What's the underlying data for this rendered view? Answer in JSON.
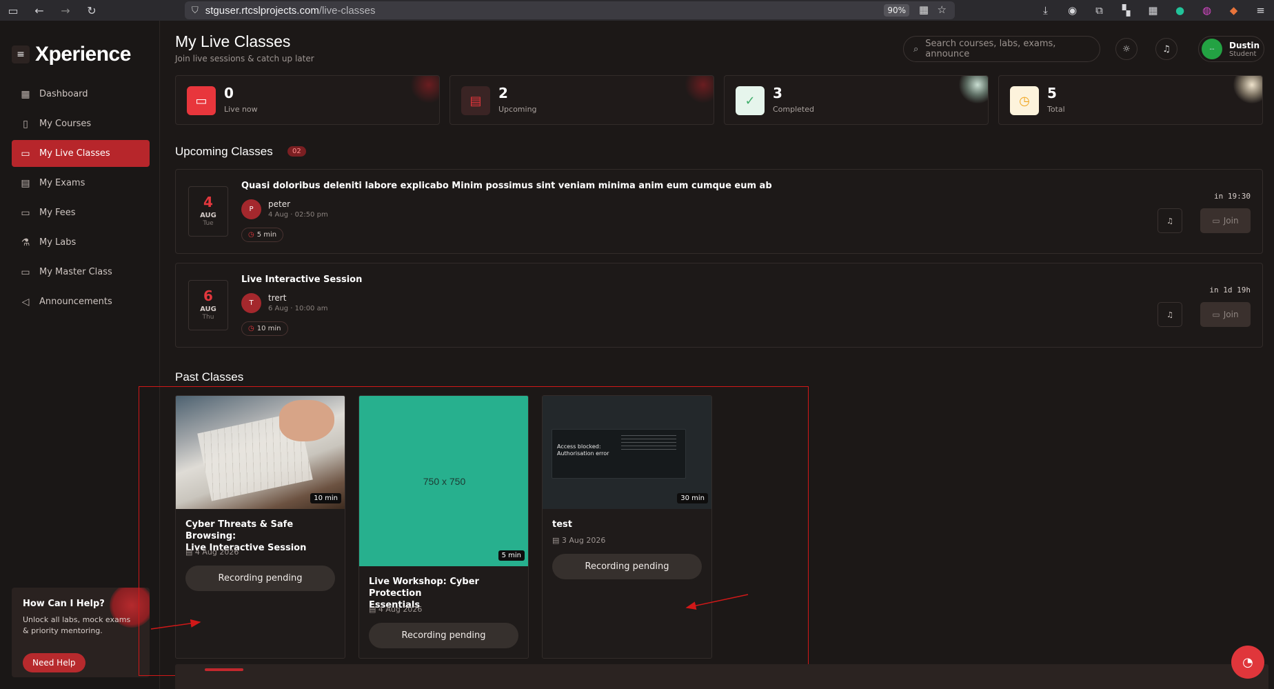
{
  "browser": {
    "url_domain": "stguser.rtcslprojects.com",
    "url_path": "/live-classes",
    "zoom": "90%"
  },
  "app": {
    "brand": "Xperience"
  },
  "sidebar": {
    "items": [
      {
        "label": "Dashboard",
        "icon": "grid-icon"
      },
      {
        "label": "My Courses",
        "icon": "book-icon"
      },
      {
        "label": "My Live Classes",
        "icon": "video-icon",
        "active": true
      },
      {
        "label": "My Exams",
        "icon": "clipboard-icon"
      },
      {
        "label": "My Fees",
        "icon": "card-icon"
      },
      {
        "label": "My Labs",
        "icon": "flask-icon"
      },
      {
        "label": "My Master Class",
        "icon": "monitor-icon"
      },
      {
        "label": "Announcements",
        "icon": "megaphone-icon"
      }
    ],
    "help": {
      "title": "How Can I Help?",
      "text": "Unlock all labs, mock exams & priority mentoring.",
      "button": "Need Help"
    }
  },
  "header": {
    "title": "My Live Classes",
    "subtitle": "Join live sessions & catch up later",
    "search_placeholder": "Search courses, labs, exams, announce",
    "user_name": "Dustin",
    "user_role": "Student",
    "avatar_text": "--"
  },
  "stats": [
    {
      "value": "0",
      "label": "Live now",
      "color": "#e8363c"
    },
    {
      "value": "2",
      "label": "Upcoming",
      "color": "#e8363c"
    },
    {
      "value": "3",
      "label": "Completed",
      "color": "#3fae6a"
    },
    {
      "value": "5",
      "label": "Total",
      "color": "#f0a51e"
    }
  ],
  "upcoming": {
    "title": "Upcoming Classes",
    "count": "02",
    "classes": [
      {
        "day": "4",
        "month": "AUG",
        "weekday": "Tue",
        "title": "Quasi doloribus deleniti labore explicabo Minim possimus sint veniam minima anim eum cumque eum ab",
        "host_initial": "P",
        "host": "peter",
        "meta": "4 Aug · 02:50 pm",
        "duration": "5 min",
        "when": "in 19:30",
        "join": "Join"
      },
      {
        "day": "6",
        "month": "AUG",
        "weekday": "Thu",
        "title": "Live Interactive Session",
        "host_initial": "T",
        "host": "trert",
        "meta": "6 Aug · 10:00 am",
        "duration": "10 min",
        "when": "in 1d 19h",
        "join": "Join"
      }
    ]
  },
  "past": {
    "title": "Past Classes",
    "classes": [
      {
        "title_line1": "Cyber Threats & Safe Browsing:",
        "title_line2": "Live Interactive Session",
        "date": "4 Aug 2026",
        "duration": "10 min",
        "status": "Recording pending"
      },
      {
        "title_line1": "Live Workshop: Cyber Protection",
        "title_line2": "Essentials",
        "date": "4 Aug 2026",
        "duration": "5 min",
        "status": "Recording pending",
        "placeholder": "750 x 750"
      },
      {
        "title_line1": "test",
        "date": "3 Aug 2026",
        "duration": "30 min",
        "status": "Recording pending",
        "thumb_text_line1": "Access blocked:",
        "thumb_text_line2": "Authorisation error"
      }
    ]
  }
}
